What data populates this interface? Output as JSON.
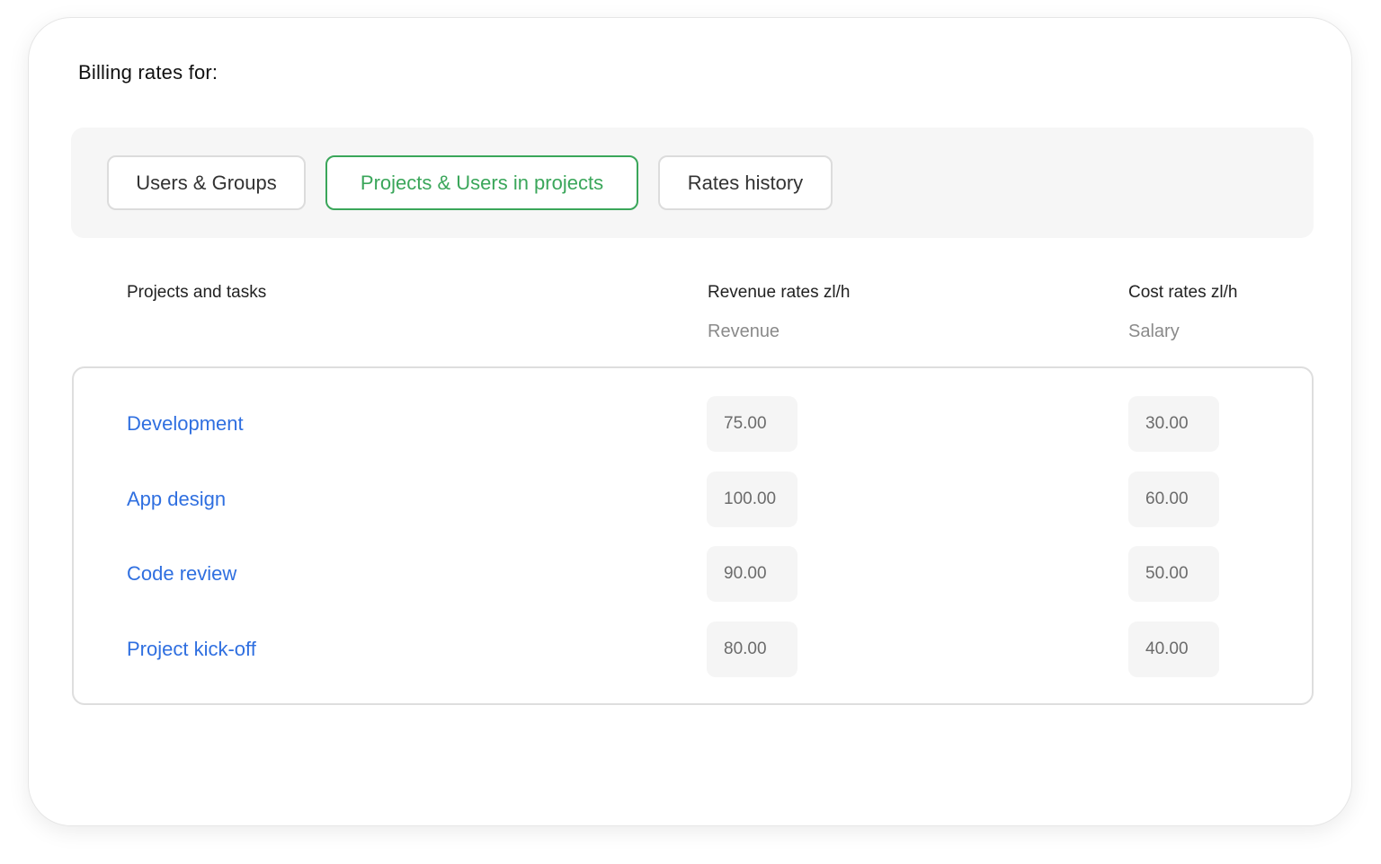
{
  "title": "Billing rates for:",
  "tabs": [
    {
      "label": "Users & Groups",
      "active": false
    },
    {
      "label": "Projects & Users in projects",
      "active": true
    },
    {
      "label": "Rates history",
      "active": false
    }
  ],
  "columns": {
    "projects": "Projects and tasks",
    "revenue": "Revenue rates zl/h",
    "revenue_sub": "Revenue",
    "cost": "Cost rates zl/h",
    "cost_sub": "Salary"
  },
  "rows": [
    {
      "name": "Development",
      "revenue": "75.00",
      "cost": "30.00"
    },
    {
      "name": "App design",
      "revenue": "100.00",
      "cost": "60.00"
    },
    {
      "name": "Code review",
      "revenue": "90.00",
      "cost": "50.00"
    },
    {
      "name": "Project kick-off",
      "revenue": "80.00",
      "cost": "40.00"
    }
  ],
  "colors": {
    "accent_active_tab": "#3aa65a",
    "link": "#2f6fe0"
  }
}
